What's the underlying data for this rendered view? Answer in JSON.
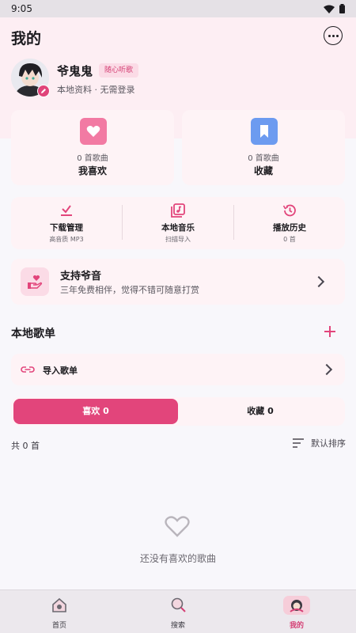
{
  "status": {
    "time": "9:05"
  },
  "header": {
    "title": "我的"
  },
  "profile": {
    "name": "爷鬼鬼",
    "badge": "随心听歌",
    "subtitle": "本地资料 · 无需登录"
  },
  "stats": [
    {
      "count": "0 首歌曲",
      "label": "我喜欢",
      "color": "#f27aa3"
    },
    {
      "count": "0 首歌曲",
      "label": "收藏",
      "color": "#6c9bf0"
    }
  ],
  "tools": [
    {
      "title": "下载管理",
      "sub": "高音质 MP3",
      "icon": "download-icon"
    },
    {
      "title": "本地音乐",
      "sub": "扫描导入",
      "icon": "music-library-icon"
    },
    {
      "title": "播放历史",
      "sub": "0 首",
      "icon": "history-icon"
    }
  ],
  "support": {
    "title": "支持爷音",
    "subtitle": "三年免费相伴，觉得不错可随意打赏"
  },
  "playlist_section": {
    "title": "本地歌单",
    "import_label": "导入歌单"
  },
  "tabs": [
    {
      "label": "喜欢 0"
    },
    {
      "label": "收藏 0"
    }
  ],
  "list": {
    "total": "共 0 首",
    "sort_label": "默认排序",
    "empty_text": "还没有喜欢的歌曲"
  },
  "nav": [
    {
      "label": "首页",
      "icon": "home-icon"
    },
    {
      "label": "搜索",
      "icon": "search-icon"
    },
    {
      "label": "我的",
      "icon": "profile-icon"
    }
  ],
  "accent_color": "#e2457b"
}
